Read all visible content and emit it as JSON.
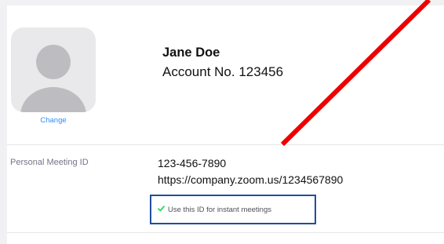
{
  "profile": {
    "change_label": "Change",
    "name": "Jane Doe",
    "account_text": "Account No. 123456"
  },
  "meeting": {
    "label": "Personal Meeting ID",
    "id": "123-456-7890",
    "url": "https://company.zoom.us/1234567890",
    "instant_option_label": "Use this ID for instant meetings",
    "instant_option_checked": true
  },
  "colors": {
    "link": "#2d8cff",
    "check": "#23d959",
    "highlight_box": "#1f4e9c",
    "annotation_line": "#ee0000"
  },
  "icons": {
    "avatar": "default-user-silhouette-icon",
    "check": "check-icon"
  }
}
